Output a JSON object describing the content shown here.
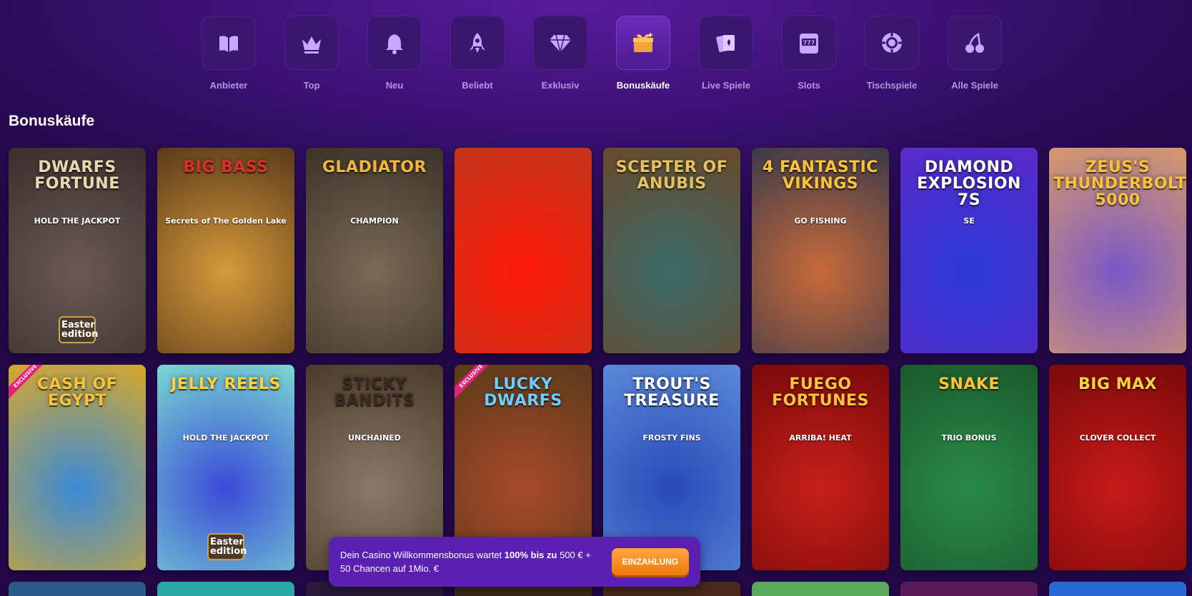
{
  "nav": {
    "items": [
      {
        "label": "Anbieter",
        "icon": "book-icon",
        "active": false
      },
      {
        "label": "Top",
        "icon": "crown-icon",
        "active": false
      },
      {
        "label": "Neu",
        "icon": "bell-icon",
        "active": false
      },
      {
        "label": "Beliebt",
        "icon": "rocket-icon",
        "active": false
      },
      {
        "label": "Exklusiv",
        "icon": "diamond-icon",
        "active": false
      },
      {
        "label": "Bonuskäufe",
        "icon": "gift-icon",
        "active": true
      },
      {
        "label": "Live Spiele",
        "icon": "cards-icon",
        "active": false
      },
      {
        "label": "Slots",
        "icon": "slot-machine-icon",
        "active": false
      },
      {
        "label": "Tischspiele",
        "icon": "chip-icon",
        "active": false
      },
      {
        "label": "Alle Spiele",
        "icon": "cherries-icon",
        "active": false
      }
    ]
  },
  "section": {
    "title": "Bonuskäufe"
  },
  "games": [
    {
      "title": "Dwarfs Fortune",
      "subtitle": "HOLD THE JACKPOT",
      "badge": "Easter edition",
      "bg": [
        "#6a5a56",
        "#3a2e2c"
      ],
      "color": "#e8d7b0",
      "exclusive": false
    },
    {
      "title": "Big Bass",
      "subtitle": "Secrets of The Golden Lake",
      "badge": "",
      "bg": [
        "#d59a3a",
        "#5a3a1a"
      ],
      "color": "#d8302a",
      "exclusive": false
    },
    {
      "title": "Gladiator",
      "subtitle": "CHAMPION",
      "badge": "",
      "bg": [
        "#7a6a55",
        "#3b3228"
      ],
      "color": "#f0b640",
      "exclusive": false
    },
    {
      "title": "",
      "subtitle": "",
      "badge": "",
      "bg": [
        "#ff1a0a",
        "#c2361a"
      ],
      "color": "#ffffff",
      "exclusive": false
    },
    {
      "title": "Scepter of Anubis",
      "subtitle": "",
      "badge": "",
      "bg": [
        "#3a6a6a",
        "#6a4a2a"
      ],
      "color": "#e8c060",
      "exclusive": false
    },
    {
      "title": "4 Fantastic Vikings",
      "subtitle": "GO FISHING",
      "badge": "",
      "bg": [
        "#c86a3a",
        "#3a3a4a"
      ],
      "color": "#f6c33a",
      "exclusive": false
    },
    {
      "title": "Diamond Explosion 7s",
      "subtitle": "SE",
      "badge": "",
      "bg": [
        "#2a3ad8",
        "#5a2ac8"
      ],
      "color": "#ffffff",
      "exclusive": false
    },
    {
      "title": "Zeus's Thunderbolt 5000",
      "subtitle": "",
      "badge": "",
      "bg": [
        "#7a58c8",
        "#d89a6a"
      ],
      "color": "#f6c33a",
      "exclusive": false
    },
    {
      "title": "Cash of Egypt",
      "subtitle": "",
      "badge": "",
      "bg": [
        "#3a8ad8",
        "#d8a82a"
      ],
      "color": "#f6c33a",
      "exclusive": true
    },
    {
      "title": "Jelly Reels",
      "subtitle": "HOLD THE JACKPOT",
      "badge": "Easter edition",
      "bg": [
        "#3a4ad8",
        "#7ad8d0"
      ],
      "color": "#ffd23a",
      "exclusive": false
    },
    {
      "title": "Sticky Bandits",
      "subtitle": "UNCHAINED",
      "badge": "",
      "bg": [
        "#8a7a6a",
        "#4a3a2a"
      ],
      "color": "#3a2a20",
      "exclusive": false
    },
    {
      "title": "Lucky Dwarfs",
      "subtitle": "",
      "badge": "",
      "bg": [
        "#a84a2a",
        "#5a3a1a"
      ],
      "color": "#6ad0ff",
      "exclusive": true
    },
    {
      "title": "Trout's Treasure",
      "subtitle": "FROSTY FINS",
      "badge": "",
      "bg": [
        "#2a4ab8",
        "#5a8ad8"
      ],
      "color": "#ffffff",
      "exclusive": false
    },
    {
      "title": "Fuego Fortunes",
      "subtitle": "ARRIBA! HEAT",
      "badge": "",
      "bg": [
        "#c8201a",
        "#7a0a0a"
      ],
      "color": "#ffc23a",
      "exclusive": false
    },
    {
      "title": "Snake",
      "subtitle": "TRIO BONUS",
      "badge": "",
      "bg": [
        "#2a8a4a",
        "#1a5a2a"
      ],
      "color": "#ffc23a",
      "exclusive": false
    },
    {
      "title": "Big Max",
      "subtitle": "CLOVER COLLECT",
      "badge": "",
      "bg": [
        "#c81a1a",
        "#7a0a0a"
      ],
      "color": "#ffd23a",
      "exclusive": false
    }
  ],
  "row3": [
    {
      "bg": "#2a5a8a"
    },
    {
      "bg": "#2aa8a8"
    },
    {
      "bg": "#2a1a3a"
    },
    {
      "bg": "#3a2a1a"
    },
    {
      "bg": "#4a2a1a"
    },
    {
      "bg": "#5aa85a"
    },
    {
      "bg": "#5a1a5a"
    },
    {
      "bg": "#2a6ad8"
    }
  ],
  "promo": {
    "text_prefix": "Dein Casino Willkommensbonus wartet ",
    "text_bold": "100% bis zu",
    "text_suffix": "500 € + 50 Chancen auf 1Mio. €",
    "button_label": "EINZAHLUNG"
  }
}
